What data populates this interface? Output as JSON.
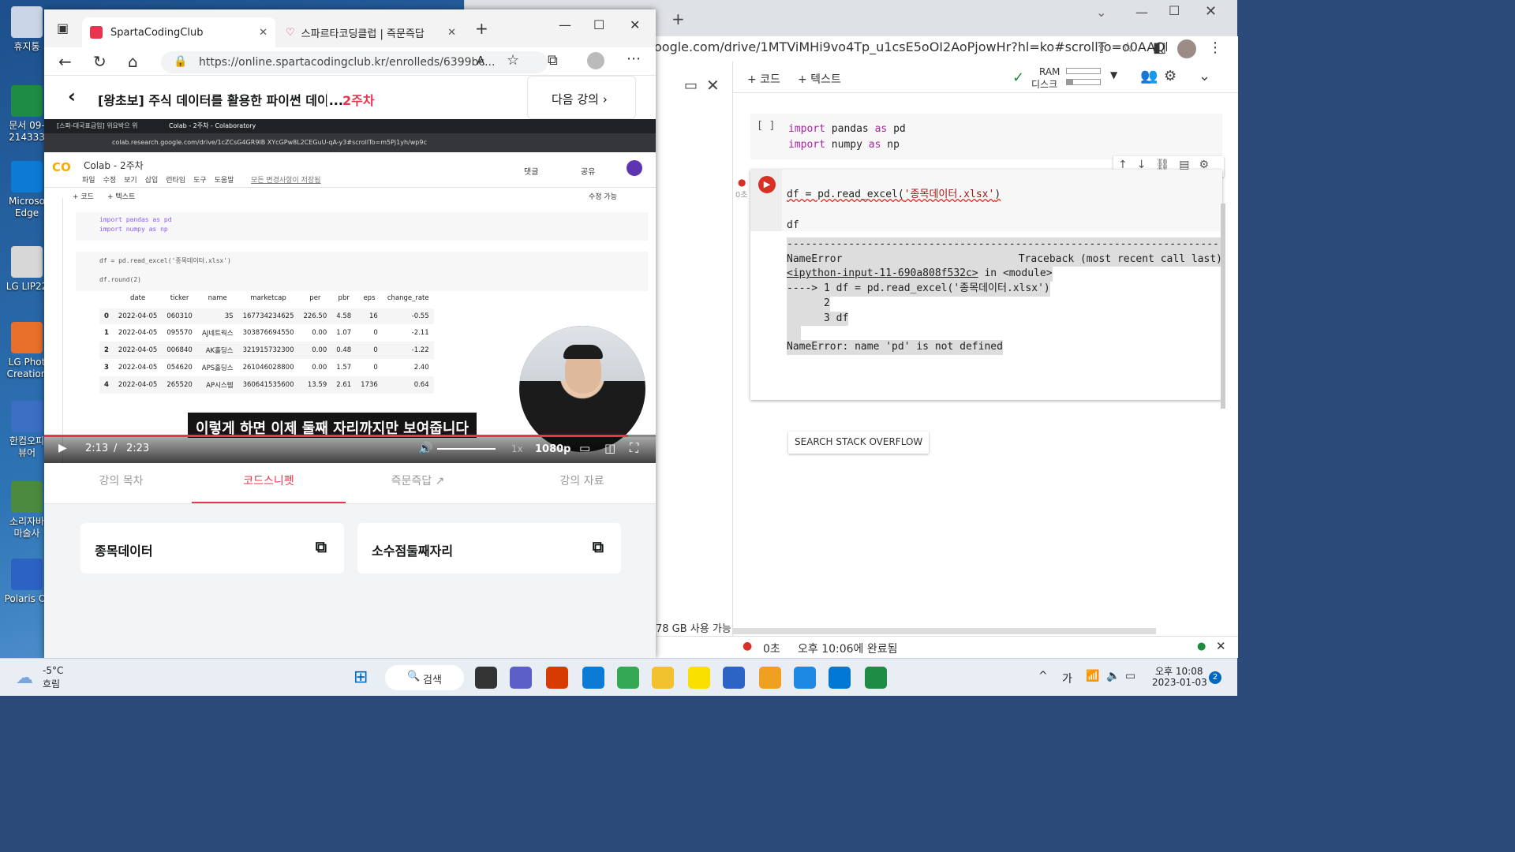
{
  "desktop": {
    "icons": [
      {
        "label": "휴지통",
        "color": "#c9d6e8"
      },
      {
        "label": "문서 09-\n214333",
        "color": "#1e8c45"
      },
      {
        "label": "Microso\nEdge",
        "color": "#0c7bd6"
      },
      {
        "label": "LG LIP22",
        "color": "#d7d7d7"
      },
      {
        "label": "LG Phot\nCreation",
        "color": "#e8702a"
      },
      {
        "label": "한컴오피\n뷰어",
        "color": "#3a6fc4"
      },
      {
        "label": "소리자바\n마술사",
        "color": "#4c8b3f"
      },
      {
        "label": "Polaris Of",
        "color": "#2c62c4"
      }
    ]
  },
  "edge": {
    "tab1": "SpartaCodingClub",
    "tab2": "스파르타코딩클럽 | 즉문즉답",
    "url": "https://online.spartacodingclub.kr/enrolleds/6399bc...",
    "course_title": "[왕초보] 주식 데이터를 활용한 파이썬 데이...",
    "week": "2주차",
    "next_button": "다음 강의"
  },
  "video": {
    "inner_tab1": "[스파-대국표급입] 위요박으 위",
    "inner_tab2": "Colab - 2주차 - Colaboratory",
    "inner_url": "colab.research.google.com/drive/1cZCsG4GR9IB XYcGPw8L2CEGuU-qA-y3#scrollTo=m5Pj1yh/wp9c",
    "notebook_title": "Colab - 2주차",
    "menu": [
      "파일",
      "수정",
      "보기",
      "삽입",
      "런타임",
      "도구",
      "도움말"
    ],
    "saved_text": "모든 변경사항이 저장됨",
    "comment": "댓글",
    "share": "공유",
    "add_code": "+ 코드",
    "add_text": "+ 텍스트",
    "edit_mode": "수정 가능",
    "cell1_line1": "import pandas as pd",
    "cell1_line2": "import numpy as np",
    "cell2_line1": "df = pd.read_excel('종목데이터.xlsx')",
    "cell2_line2": "df.round(2)",
    "table_headers": [
      "",
      "date",
      "ticker",
      "name",
      "marketcap",
      "per",
      "pbr",
      "eps",
      "change_rate"
    ],
    "table_rows": [
      [
        "0",
        "2022-04-05",
        "060310",
        "3S",
        "167734234625",
        "226.50",
        "4.58",
        "16",
        "-0.55"
      ],
      [
        "1",
        "2022-04-05",
        "095570",
        "AJ네트웍스",
        "303876694550",
        "0.00",
        "1.07",
        "0",
        "-2.11"
      ],
      [
        "2",
        "2022-04-05",
        "006840",
        "AK홀딩스",
        "321915732300",
        "0.00",
        "0.48",
        "0",
        "-1.22"
      ],
      [
        "3",
        "2022-04-05",
        "054620",
        "APS홀딩스",
        "261046028800",
        "0.00",
        "1.57",
        "0",
        "2.40"
      ],
      [
        "4",
        "2022-04-05",
        "265520",
        "AP시스템",
        "360641535600",
        "13.59",
        "2.61",
        "1736",
        "0.64"
      ]
    ],
    "subtitle": "이렇게 하면 이제 둘째 자리까지만 보여줍니다",
    "current_time": "2:13",
    "separator": "/",
    "duration": "2:23",
    "speed": "1x",
    "quality": "1080p",
    "progress": 0.955
  },
  "lecture_tabs": [
    "강의 목차",
    "코드스니펫",
    "즉문즉답",
    "강의 자료"
  ],
  "snippets": [
    "종목데이터",
    "소수점둘째자리"
  ],
  "chrome": {
    "url": "oogle.com/drive/1MTViMHi9vo4Tp_u1csE5oOI2AoPjowHr?hl=ko#scrollTo=o0AAQll...",
    "add_code": "+ 코드",
    "add_text": "+ 텍스트",
    "ram": "RAM",
    "disk": "디스크",
    "cell1_bracket": "[ ]",
    "cell1_line1_kw": "import",
    "cell1_line1_rest": " pandas ",
    "cell1_as": "as",
    "cell1_pd": " pd",
    "cell1_line2_kw": "import",
    "cell1_line2_rest": " numpy ",
    "cell1_np": " np",
    "cell2_line1_a": "df = pd.read_excel(",
    "cell2_line1_str": "'종목데이터.xlsx'",
    "cell2_line1_b": ")",
    "cell2_line2": "df",
    "run_time": "0초",
    "err_dash": "---------------------------------------------------------------------------",
    "err_name": "NameError",
    "err_traceback": "Traceback (most recent call last)",
    "err_link": "<ipython-input-11-690a808f532c>",
    "err_in": " in <module>",
    "err_line1": "----> 1 df = pd.read_excel('종목데이터.xlsx')",
    "err_line2": "      2",
    "err_line3": "      3 df",
    "err_final": "NameError: name 'pd' is not defined",
    "so_button": "SEARCH STACK OVERFLOW",
    "disk_free": "78 GB 사용 가능",
    "status_time": "0초",
    "status_done": "오후 10:06에 완료됨"
  },
  "taskbar": {
    "temp": "-5°C",
    "weather": "흐림",
    "search": "검색",
    "ime": "가",
    "time": "오후 10:08",
    "date": "2023-01-03",
    "notif": "2"
  }
}
